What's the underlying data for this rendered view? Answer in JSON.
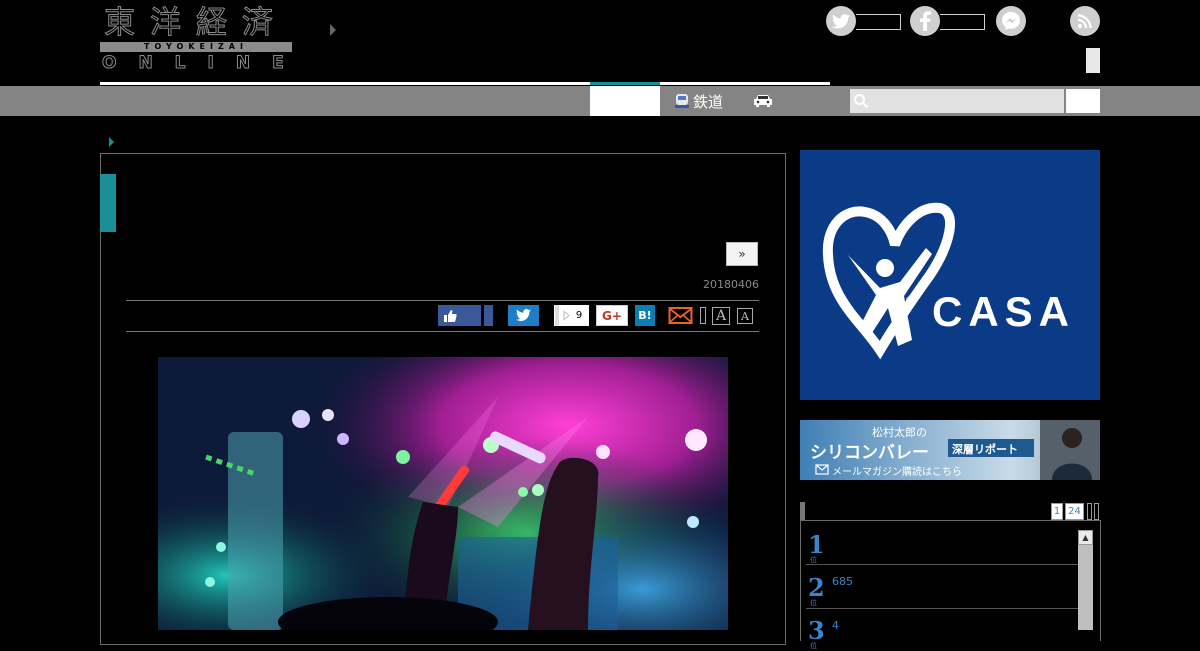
{
  "header": {
    "logo_kanji": "東洋経済",
    "logo_romaji": "TOYOKEIZAI",
    "logo_online": "ONLINE"
  },
  "nav": {
    "items": [
      {
        "label": "鉄道",
        "icon": "train-icon"
      },
      {
        "label": "",
        "icon": "car-icon"
      }
    ],
    "search_placeholder": ""
  },
  "article": {
    "next_label": "»",
    "date": "20180406",
    "share": {
      "pocket_count": "9",
      "gplus_label": "G+",
      "hatena_label": "B!",
      "font_large": "A",
      "font_small": "A"
    }
  },
  "sidebar": {
    "ad_casa_text": "CASA",
    "ad_casa_mark": "®",
    "ad_sv_line1": "松村太郎の",
    "ad_sv_line2": "シリコンバレー",
    "ad_sv_line3": "深層リポート",
    "ad_sv_line4": "メールマガジン購読はこちら",
    "ranking": {
      "tabs": [
        "1",
        "24"
      ],
      "items": [
        {
          "rank": "1",
          "sub": "位",
          "text": ""
        },
        {
          "rank": "2",
          "sub": "位",
          "text": "685"
        },
        {
          "rank": "3",
          "sub": "位",
          "text": "4"
        }
      ]
    }
  },
  "colors": {
    "accent": "#1b8f96",
    "nav_bg": "#848484",
    "casa_bg": "#0b3b86",
    "link": "#3a84c9"
  }
}
